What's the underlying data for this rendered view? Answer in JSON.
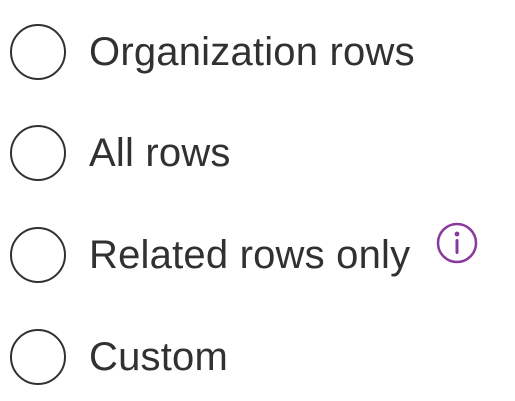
{
  "options": [
    {
      "label": "Organization rows",
      "selected": false
    },
    {
      "label": "All rows",
      "selected": false
    },
    {
      "label": "Related rows only",
      "selected": false,
      "info_icon": "info-icon"
    },
    {
      "label": "Custom",
      "selected": false
    }
  ],
  "colors": {
    "text": "#323130",
    "radio_border": "#323130",
    "info_icon": "#8a3a9c"
  }
}
